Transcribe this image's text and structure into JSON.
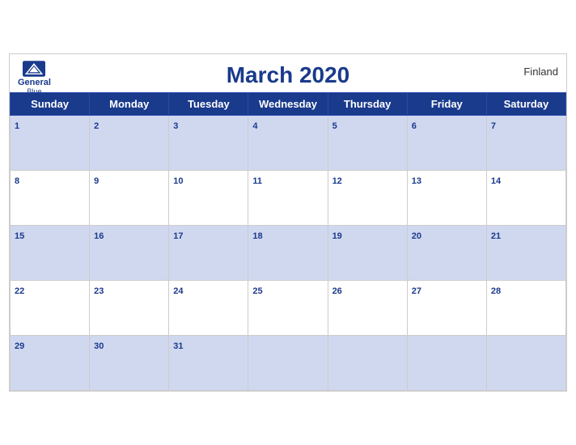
{
  "header": {
    "title": "March 2020",
    "country": "Finland",
    "brand_general": "General",
    "brand_blue": "Blue"
  },
  "weekdays": [
    "Sunday",
    "Monday",
    "Tuesday",
    "Wednesday",
    "Thursday",
    "Friday",
    "Saturday"
  ],
  "weeks": [
    {
      "shaded": true,
      "days": [
        1,
        2,
        3,
        4,
        5,
        6,
        7
      ]
    },
    {
      "shaded": false,
      "days": [
        8,
        9,
        10,
        11,
        12,
        13,
        14
      ]
    },
    {
      "shaded": true,
      "days": [
        15,
        16,
        17,
        18,
        19,
        20,
        21
      ]
    },
    {
      "shaded": false,
      "days": [
        22,
        23,
        24,
        25,
        26,
        27,
        28
      ]
    },
    {
      "shaded": true,
      "days": [
        29,
        30,
        31,
        null,
        null,
        null,
        null
      ]
    }
  ]
}
